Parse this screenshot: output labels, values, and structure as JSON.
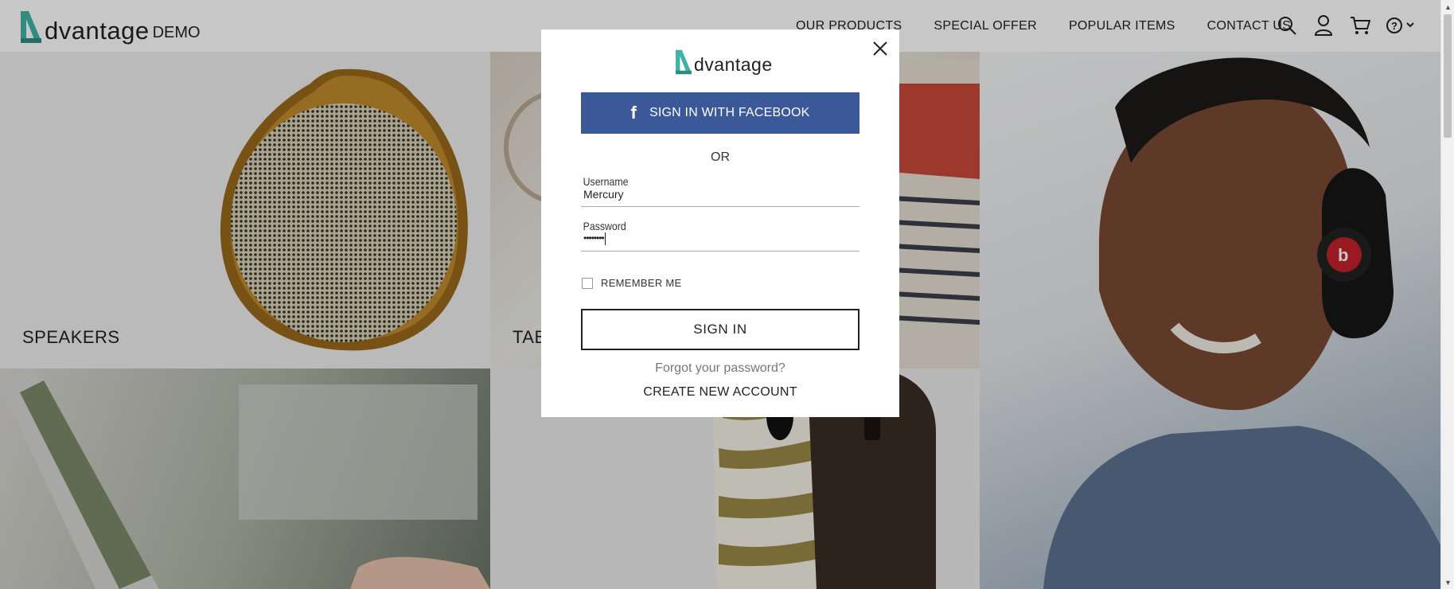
{
  "header": {
    "logo_word": "dvantage",
    "logo_demo": "DEMO",
    "nav": [
      "OUR PRODUCTS",
      "SPECIAL OFFER",
      "POPULAR ITEMS",
      "CONTACT US"
    ],
    "icons": [
      "search-icon",
      "user-icon",
      "cart-icon",
      "help-icon"
    ]
  },
  "tiles": {
    "speakers": "SPEAKERS",
    "tablets": "TABLETS"
  },
  "modal": {
    "logo_word": "dvantage",
    "facebook_label": "SIGN IN WITH FACEBOOK",
    "or_label": "OR",
    "username_label": "Username",
    "username_value": "Mercury",
    "password_label": "Password",
    "password_value": "••••••••",
    "remember_label": "REMEMBER ME",
    "signin_label": "SIGN IN",
    "forgot_label": "Forgot your password?",
    "create_label": "CREATE NEW ACCOUNT"
  },
  "colors": {
    "brand_teal": "#3fb3a6",
    "facebook_blue": "#3b5998",
    "overlay": "rgba(0,0,0,0.22)"
  }
}
